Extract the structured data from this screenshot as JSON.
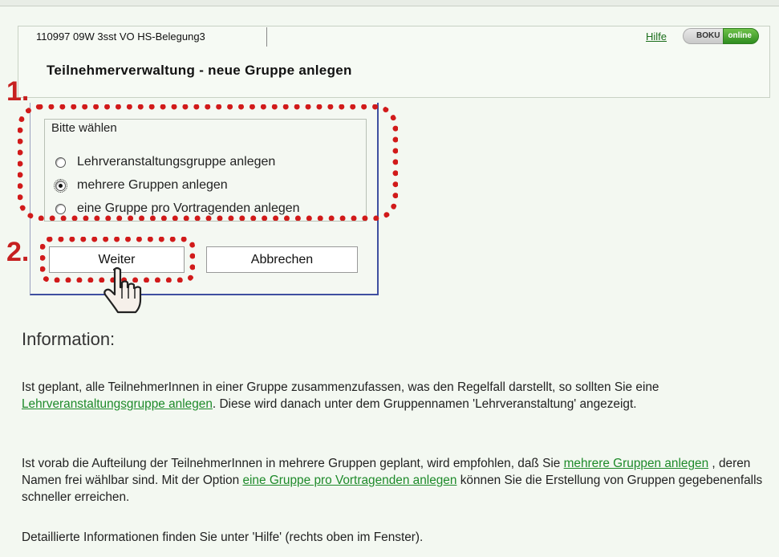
{
  "header": {
    "course": "110997 09W 3sst VO HS-Belegung3",
    "help_link": "Hilfe",
    "logo_left": "BOKU",
    "logo_right": "online",
    "title": "Teilnehmerverwaltung - neue Gruppe anlegen"
  },
  "markers": {
    "one": "1.",
    "two": "2."
  },
  "dialog": {
    "legend": "Bitte wählen",
    "options": [
      {
        "label": "Lehrveranstaltungsgruppe anlegen",
        "checked": false
      },
      {
        "label": "mehrere Gruppen anlegen",
        "checked": true
      },
      {
        "label": "eine Gruppe pro Vortragenden anlegen",
        "checked": false
      }
    ],
    "next_button": "Weiter",
    "cancel_button": "Abbrechen"
  },
  "info": {
    "heading": "Information:",
    "p1_a": "Ist geplant, alle TeilnehmerInnen in einer Gruppe zusammenzufassen, was den Regelfall darstellt, so sollten Sie eine ",
    "p1_link": "Lehrveranstaltungsgruppe anlegen",
    "p1_b": ". Diese wird danach unter dem Gruppennamen 'Lehrveranstaltung' angezeigt.",
    "p2_a": "Ist vorab die Aufteilung der TeilnehmerInnen in mehrere Gruppen geplant, wird empfohlen, daß Sie ",
    "p2_link1": "mehrere Gruppen anlegen",
    "p2_b": " , deren Namen frei wählbar sind. Mit der Option ",
    "p2_link2": "eine Gruppe pro Vortragenden anlegen",
    "p2_c": " können Sie die Erstellung von Gruppen gegebenenfalls schneller erreichen.",
    "p3": "Detaillierte Informationen finden Sie unter 'Hilfe' (rechts oben im Fenster)."
  },
  "colors": {
    "accent_green": "#1e8a2a",
    "highlight_red": "#d11a1a",
    "dialog_border": "#3f4fa0"
  }
}
